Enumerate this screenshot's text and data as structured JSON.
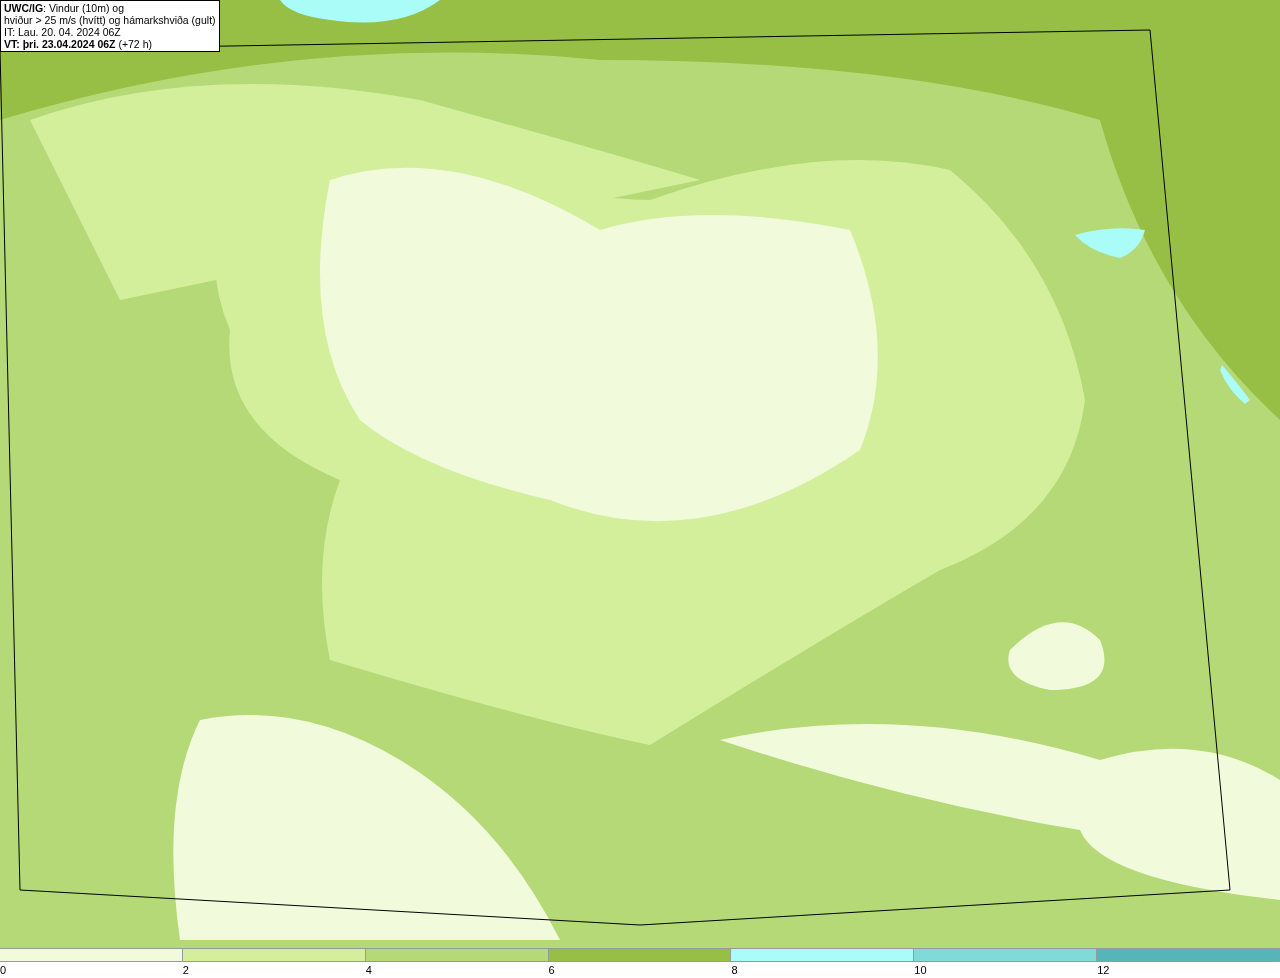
{
  "title_box": {
    "lines": [
      "**UWC/IG**: Vindur (10m) og",
      "hviður > 25 m/s (hvítt) og hámarkshviða (gult)",
      "IT: Lau. 20. 04. 2024 06Z",
      "**VT: þri. 23.04.2024 06Z** (+72 h)"
    ]
  },
  "legend": {
    "segments": [
      {
        "color": "#f2fadc",
        "label": "0"
      },
      {
        "color": "#d4ef9c",
        "label": "2"
      },
      {
        "color": "#b5d977",
        "label": "4"
      },
      {
        "color": "#97bf46",
        "label": "6"
      },
      {
        "color": "#aafcf8",
        "label": "8"
      },
      {
        "color": "#80dad9",
        "label": "10"
      },
      {
        "color": "#55b5b8",
        "label": "12"
      }
    ]
  }
}
